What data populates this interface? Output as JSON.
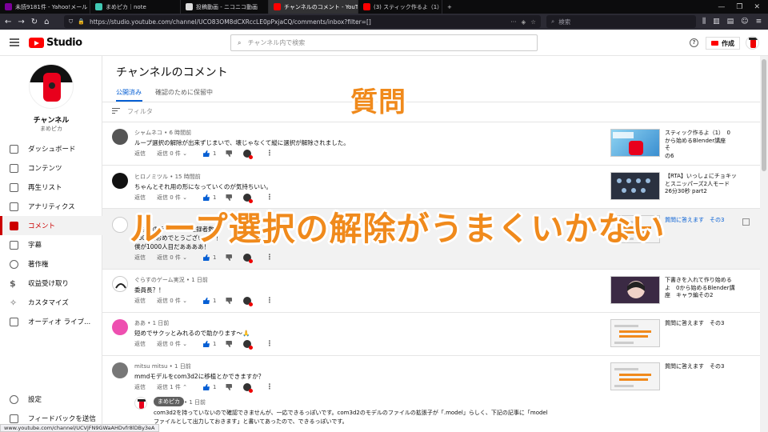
{
  "browser": {
    "tabs": [
      {
        "label": "未読9181件 - Yahoo!メール",
        "color": "#7b0099"
      },
      {
        "label": "まめピカ｜note",
        "color": "#41c9b4"
      },
      {
        "label": "投稿動画 - ニコニコ動画",
        "color": "#dddddd"
      },
      {
        "label": "チャンネルのコメント - YouTube Studio",
        "color": "#ff0000",
        "active": true
      },
      {
        "label": "(3) スティック作るよ（1）　0から…",
        "color": "#ff0000"
      }
    ],
    "url": "https://studio.youtube.com/channel/UCO83OM8dCXRccLE0pPxjaCQ/comments/inbox?filter=[]",
    "search_placeholder": "検索",
    "status_url": "www.youtube.com/channel/UCVjFN9GWaAHDvfr8lDBy3eA"
  },
  "studio": {
    "logo_text": "Studio",
    "search_placeholder": "チャンネル内で検索",
    "create_label": "作成",
    "help_glyph": "?"
  },
  "sidebar": {
    "channel_label": "チャンネル",
    "channel_name": "まめピカ",
    "items": [
      {
        "label": "ダッシュボード"
      },
      {
        "label": "コンテンツ"
      },
      {
        "label": "再生リスト"
      },
      {
        "label": "アナリティクス"
      },
      {
        "label": "コメント",
        "active": true
      },
      {
        "label": "字幕"
      },
      {
        "label": "著作権"
      },
      {
        "label": "収益受け取り"
      },
      {
        "label": "カスタマイズ"
      },
      {
        "label": "オーディオ ライブ..."
      }
    ],
    "bottom_items": [
      {
        "label": "設定"
      },
      {
        "label": "フィードバックを送信"
      }
    ]
  },
  "main": {
    "title": "チャンネルのコメント",
    "tabs": [
      "公開済み",
      "確認のために保留中"
    ],
    "filter_placeholder": "フィルタ",
    "reply_label": "返信",
    "comments": [
      {
        "author": "シャムネコ",
        "time": "6 時間前",
        "text": "ループ選択の解除が出来ずじまいで、壊じゃなくて縦に選択が解除されました。",
        "replies_label": "返信 0 件",
        "likes": "1",
        "video_title": "スティック作るよ（1）　0\nから始めるBlender講座　そ\nの6"
      },
      {
        "author": "ヒロノミツル",
        "time": "15 時間前",
        "text": "ちゃんとそれ用の形になっていくのが気持ちいい。",
        "replies_label": "返信 0 件",
        "likes": "1",
        "video_title": "【RTA】いっしょにチョキッ\nとスニッパーズ2人モード\n26分30秒 part2"
      },
      {
        "author": "",
        "time": "",
        "text": "あなたのチャンネル 登録者数",
        "text2": "1000人おめでとうございます！",
        "text3": "僕が1000人目だああああ！",
        "replies_label": "返信 0 件",
        "likes": "1",
        "video_title": "質問に答えます　その3"
      },
      {
        "author": "ぐらすのゲーム実況",
        "time": "1 日前",
        "text": "委員長？！",
        "replies_label": "返信 0 件",
        "likes": "1",
        "video_title": "下書きを入れて作り始める\nよ　0から始めるBlender講\n座　キャラ編その2"
      },
      {
        "author": "ああ",
        "time": "1 日前",
        "text": "短めでサクッとみれるので助かります〜🙏",
        "replies_label": "返信 0 件",
        "likes": "1",
        "video_title": "質問に答えます　その3"
      },
      {
        "author": "mitsu mitsu",
        "time": "1 日前",
        "text": "mmdモデルをcom3d2に移植とかできますか？",
        "replies_label": "返信 1 件",
        "likes": "1",
        "video_title": "質問に答えます　その3"
      }
    ],
    "reply": {
      "author": "まめピカ",
      "time": "1 日前",
      "line1": "com3d2を持っていないので確認できませんが、一応できるっぽいです。com3d2のモデルのファイルの拡張子が「.model」らしく、下記の記事に「model",
      "line2": "ファイルとして出力しておきます」と書いてあったので、できるっぽいです。"
    }
  },
  "overlays": {
    "top": "質問",
    "middle": "ループ選択の解除がうまくいかない"
  },
  "colors": {
    "accent_blue": "#065fd4",
    "youtube_red": "#ff0000",
    "overlay_orange": "#f08a1c"
  }
}
